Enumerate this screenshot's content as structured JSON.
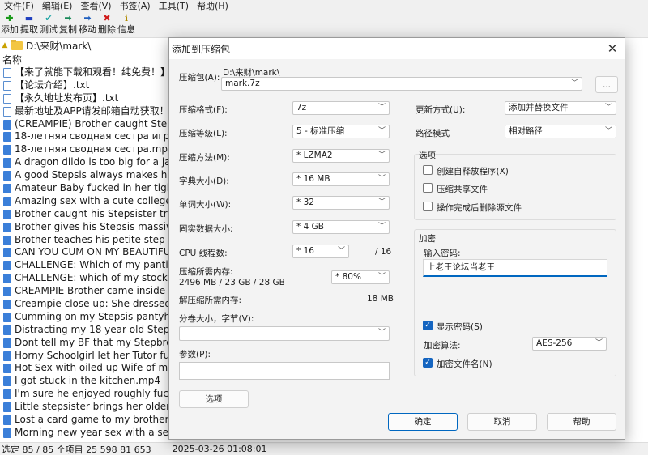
{
  "menu": [
    "文件(F)",
    "编辑(E)",
    "查看(V)",
    "书签(A)",
    "工具(T)",
    "帮助(H)"
  ],
  "toolbar": [
    {
      "label": "添加",
      "icon": "plus-icon",
      "glyph": "✚",
      "color": "#1a9a1a"
    },
    {
      "label": "提取",
      "icon": "minus-icon",
      "glyph": "▬",
      "color": "#1f3fbf"
    },
    {
      "label": "测试",
      "icon": "check-icon",
      "glyph": "✔",
      "color": "#1aa3a3"
    },
    {
      "label": "复制",
      "icon": "copy-arrow-icon",
      "glyph": "➡",
      "color": "#1a8a5a"
    },
    {
      "label": "移动",
      "icon": "move-arrow-icon",
      "glyph": "➡",
      "color": "#1f5fbf"
    },
    {
      "label": "删除",
      "icon": "delete-icon",
      "glyph": "✖",
      "color": "#d01a1a"
    },
    {
      "label": "信息",
      "icon": "info-icon",
      "glyph": "ℹ",
      "color": "#b08a00"
    }
  ],
  "address": {
    "path": "D:\\来财\\mark\\"
  },
  "filelist": {
    "column_name": "名称",
    "files": [
      {
        "name": "【来了就能下载和观看！纯免费！】.txt",
        "type": "txt"
      },
      {
        "name": "【论坛介绍】.txt",
        "type": "txt"
      },
      {
        "name": "【永久地址发布页】.txt",
        "type": "txt"
      },
      {
        "name": "最新地址及APP请发邮箱自动获取！！！",
        "type": "txt"
      },
      {
        "name": "(CREAMPIE) Brother caught Stepsiste",
        "type": "video"
      },
      {
        "name": "18-летняя сводная сестра играет в ки",
        "type": "video"
      },
      {
        "name": "18-летняя сводная сестра.mp4",
        "type": "video"
      },
      {
        "name": "A dragon dildo is too big for a japane",
        "type": "video"
      },
      {
        "name": "A good Stepsis always makes her Bro",
        "type": "video"
      },
      {
        "name": "Amateur Baby fucked in her tight Pus",
        "type": "video"
      },
      {
        "name": "Amazing sex with a cute college stud",
        "type": "video"
      },
      {
        "name": "Brother caught his Stepsister trying o",
        "type": "video"
      },
      {
        "name": "Brother gives his Stepsis massive load",
        "type": "video"
      },
      {
        "name": "Brother teaches his petite step-sister",
        "type": "video"
      },
      {
        "name": "CAN YOU CUM ON MY BEAUTIFUL A",
        "type": "video"
      },
      {
        "name": "CHALLENGE:  Which of my panties w",
        "type": "video"
      },
      {
        "name": "CHALLENGE:  which of my stockings",
        "type": "video"
      },
      {
        "name": "CREAMPIE Brother came inside his ste",
        "type": "video"
      },
      {
        "name": "Creampie close up:  She dressed up",
        "type": "video"
      },
      {
        "name": "Cumming on my Stepsis pantyhose (",
        "type": "video"
      },
      {
        "name": "Distracting my 18 year old Stepsis fro",
        "type": "video"
      },
      {
        "name": "Dont tell my BF that my Stepbrother",
        "type": "video"
      },
      {
        "name": "Horny Schoolgirl let her Tutor fuck he",
        "type": "video"
      },
      {
        "name": "Hot Sex with oiled up Wife of my Bes",
        "type": "video"
      },
      {
        "name": "I got stuck in the kitchen.mp4",
        "type": "video"
      },
      {
        "name": "I'm sure he enjoyed roughly fucking",
        "type": "video"
      },
      {
        "name": "Little stepsister brings her older stepb",
        "type": "video"
      },
      {
        "name": "Lost a card game to my brother's bes",
        "type": "video"
      },
      {
        "name": "Morning new year sex with a sexy ste",
        "type": "video"
      }
    ]
  },
  "status": {
    "selection": "选定 85 / 85 个项目 25 598 81 653",
    "datetime": "2025-03-26 01:08:01"
  },
  "dialog": {
    "title": "添加到压缩包",
    "archive_label": "压缩包(A):",
    "archive_dir": "D:\\来财\\mark\\",
    "archive_name": "mark.7z",
    "browse_label": "...",
    "format_label": "压缩格式(F):",
    "format_value": "7z",
    "level_label": "压缩等级(L):",
    "level_value": "5 - 标准压缩",
    "method_label": "压缩方法(M):",
    "method_value": "*  LZMA2",
    "dict_label": "字典大小(D):",
    "dict_value": "*  16 MB",
    "word_label": "单词大小(W):",
    "word_value": "*  32",
    "solid_label": "固实数据大小:",
    "solid_value": "*  4 GB",
    "threads_label": "CPU 线程数:",
    "threads_value": "*  16",
    "threads_max": "/ 16",
    "mem_compress_label": "压缩所需内存:",
    "mem_compress_value": "2496 MB / 23 GB / 28 GB",
    "mem_percent": "* 80%",
    "mem_decompress_label": "解压缩所需内存:",
    "mem_decompress_value": "18 MB",
    "split_label": "分卷大小，字节(V):",
    "split_value": "",
    "params_label": "参数(P):",
    "params_value": "",
    "options_button": "选项",
    "update_label": "更新方式(U):",
    "update_value": "添加并替换文件",
    "pathmode_label": "路径模式",
    "pathmode_value": "相对路径",
    "options_group": "选项",
    "opt_sfx": "创建自释放程序(X)",
    "opt_shared": "压缩共享文件",
    "opt_delete": "操作完成后删除源文件",
    "encrypt_group": "加密",
    "password_label": "输入密码:",
    "password_value": "上老王论坛当老王",
    "show_password_label": "显示密码(S)",
    "enc_method_label": "加密算法:",
    "enc_method_value": "AES-256",
    "encrypt_names_label": "加密文件名(N)",
    "ok_button": "确定",
    "cancel_button": "取消",
    "help_button": "帮助"
  }
}
